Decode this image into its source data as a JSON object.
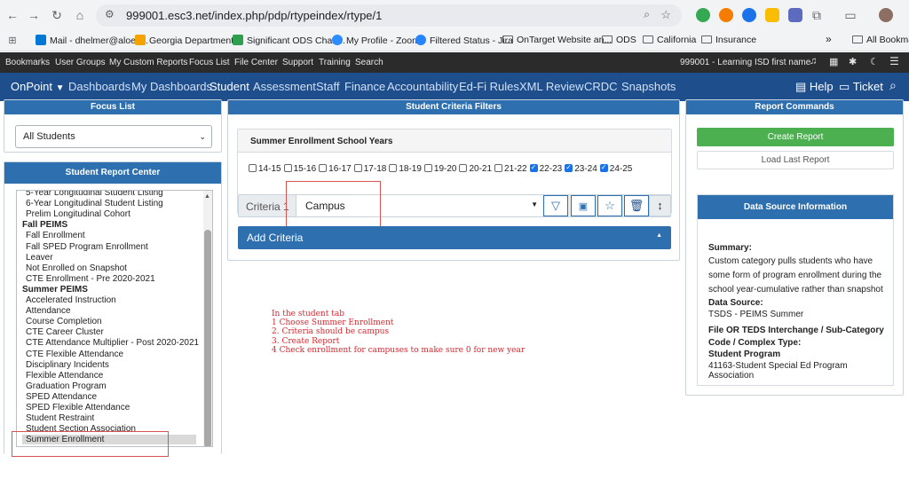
{
  "browser": {
    "url": "999001.esc3.net/index.php/pdp/rtypeindex/rtype/1",
    "bookmarks": [
      "Mail - dhelmer@aloes...",
      "Georgia Department...",
      "Significant ODS Chan...",
      "My Profile - Zoom",
      "Filtered Status - Jira",
      "OnTarget Website an...",
      "ODS",
      "California",
      "Insurance",
      "All Bookmarks"
    ],
    "more_label": "»"
  },
  "top_menu": {
    "items": [
      "Bookmarks",
      "User Groups",
      "My Custom Reports",
      "Focus List",
      "File Center",
      "Support",
      "Training",
      "Search"
    ],
    "user_text": "999001 - Learning ISD first name"
  },
  "main_nav": {
    "brand": "OnPoint",
    "items": [
      "Dashboards",
      "My Dashboards",
      "Student",
      "Assessment",
      "Staff",
      "Finance",
      "Accountability",
      "Ed-Fi Rules",
      "XML Review",
      "CRDC",
      "Snapshots"
    ],
    "help": "Help",
    "ticket": "Ticket"
  },
  "focus_list": {
    "title": "Focus List",
    "selected": "All Students"
  },
  "report_center": {
    "title": "Student Report Center",
    "items": [
      {
        "label": "5-Year Longitudinal Student Listing",
        "kind": "item"
      },
      {
        "label": "6-Year Longitudinal Student Listing",
        "kind": "item"
      },
      {
        "label": "Prelim Longitudinal Cohort",
        "kind": "item"
      },
      {
        "label": "Fall PEIMS",
        "kind": "group"
      },
      {
        "label": "Fall Enrollment",
        "kind": "item"
      },
      {
        "label": "Fall SPED Program Enrollment",
        "kind": "item"
      },
      {
        "label": "Leaver",
        "kind": "item"
      },
      {
        "label": "Not Enrolled on Snapshot",
        "kind": "item"
      },
      {
        "label": "CTE Enrollment - Pre 2020-2021",
        "kind": "item"
      },
      {
        "label": "Summer PEIMS",
        "kind": "group"
      },
      {
        "label": "Accelerated Instruction",
        "kind": "item"
      },
      {
        "label": "Attendance",
        "kind": "item"
      },
      {
        "label": "Course Completion",
        "kind": "item"
      },
      {
        "label": "CTE Career Cluster",
        "kind": "item"
      },
      {
        "label": "CTE Attendance Multiplier - Post 2020-2021",
        "kind": "item"
      },
      {
        "label": "CTE Flexible Attendance",
        "kind": "item"
      },
      {
        "label": "Disciplinary Incidents",
        "kind": "item"
      },
      {
        "label": "Flexible Attendance",
        "kind": "item"
      },
      {
        "label": "Graduation Program",
        "kind": "item"
      },
      {
        "label": "SPED Attendance",
        "kind": "item"
      },
      {
        "label": "SPED Flexible Attendance",
        "kind": "item"
      },
      {
        "label": "Student Restraint",
        "kind": "item"
      },
      {
        "label": "Student Section Association",
        "kind": "item"
      },
      {
        "label": "Summer Enrollment",
        "kind": "selected"
      }
    ]
  },
  "criteria": {
    "title": "Student Criteria Filters",
    "years_title": "Summer Enrollment School Years",
    "years": [
      {
        "label": "14-15",
        "checked": false
      },
      {
        "label": "15-16",
        "checked": false
      },
      {
        "label": "16-17",
        "checked": false
      },
      {
        "label": "17-18",
        "checked": false
      },
      {
        "label": "18-19",
        "checked": false
      },
      {
        "label": "19-20",
        "checked": false
      },
      {
        "label": "20-21",
        "checked": false
      },
      {
        "label": "21-22",
        "checked": false
      },
      {
        "label": "22-23",
        "checked": true
      },
      {
        "label": "23-24",
        "checked": true
      },
      {
        "label": "24-25",
        "checked": true
      }
    ],
    "criteria_label": "Criteria 1",
    "criteria_value": "Campus",
    "add_criteria": "Add Criteria"
  },
  "instructions": [
    "In the student tab",
    "1 Choose Summer Enrollment",
    "2. Criteria should be campus",
    "3.  Create Report",
    "4 Check enrollment for campuses to make sure 0 for new year"
  ],
  "report_commands": {
    "title": "Report Commands",
    "create": "Create Report",
    "load": "Load Last Report"
  },
  "data_source": {
    "title": "Data Source Information",
    "summary_label": "Summary:",
    "summary_text": "Custom category pulls students who have some form of program enrollment during the school year-cumulative rather than snapshot",
    "source_label": "Data Source:",
    "source_value": "TSDS - PEIMS Summer",
    "interchange_label": "File OR TEDS Interchange / Sub-Category Code / Complex Type:",
    "interchange_value_label": "Student Program",
    "interchange_value": "41163-Student Special Ed Program Association"
  },
  "colors": {
    "nav_bg": "#1f4e8c",
    "panel_head": "#2e6fb0",
    "create_btn": "#4caf50",
    "annotation_red": "#d4282f"
  }
}
